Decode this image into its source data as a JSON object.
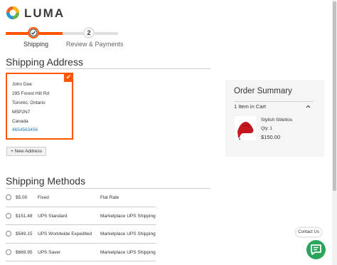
{
  "brand": {
    "name": "LUMA",
    "accent": "#ff5501",
    "link": "#1979c3",
    "logo_icon": "luma-logo-icon"
  },
  "progress": {
    "steps": [
      {
        "number": "1",
        "label": "Shipping",
        "state": "active"
      },
      {
        "number": "2",
        "label": "Review & Payments",
        "state": "pending"
      }
    ]
  },
  "shipping_address": {
    "title": "Shipping Address",
    "selected": {
      "name": "John Doe",
      "street": "295 Forest Hill Rd",
      "city_region": "Toronto, Ontario",
      "postcode": "M5P2N7",
      "country": "Canada",
      "phone": "4654563456"
    },
    "new_address_label": "+ New Address"
  },
  "shipping_methods": {
    "title": "Shipping Methods",
    "rows": [
      {
        "price": "$5.00",
        "method": "Fixed",
        "carrier": "Flat Rate"
      },
      {
        "price": "$151.48",
        "method": "UPS Standard",
        "carrier": "Marketplace UPS Shipping"
      },
      {
        "price": "$549.15",
        "method": "UPS Worldwide Expedited",
        "carrier": "Marketplace UPS Shipping"
      },
      {
        "price": "$669.95",
        "method": "UPS Saver",
        "carrier": "Marketplace UPS Shipping"
      }
    ]
  },
  "order_summary": {
    "title": "Order Summary",
    "items_label": "1 Item in Cart",
    "item": {
      "name": "Stylish Stilettos",
      "qty": "Qty: 1",
      "price": "$150.00"
    }
  },
  "contact": {
    "label": "Contact Us",
    "icon": "chat-icon",
    "color": "#2aa65c"
  }
}
